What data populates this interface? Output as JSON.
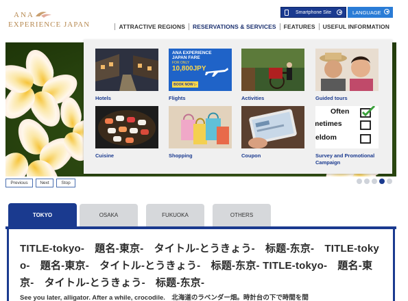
{
  "logo": {
    "line1": "ANA",
    "line2": "EXPERIENCE JAPAN"
  },
  "top_buttons": {
    "smartphone": "Smartphone Site",
    "language": "LANGUAGE"
  },
  "nav": [
    {
      "label": "ATTRACTIVE REGIONS"
    },
    {
      "label": "RESERVATIONS & SERVICES"
    },
    {
      "label": "FEATURES"
    },
    {
      "label": "USEFUL INFORMATION"
    }
  ],
  "dropdown": {
    "items": [
      {
        "label": "Hotels"
      },
      {
        "label": "Flights"
      },
      {
        "label": "Activities"
      },
      {
        "label": "Guided tours"
      },
      {
        "label": "Cuisine"
      },
      {
        "label": "Shopping"
      },
      {
        "label": "Coupon"
      },
      {
        "label": "Survey and Promotional Campaign"
      }
    ],
    "flights_ad": {
      "line1": "ANA EXPERIENCE",
      "line2": "JAPAN FARE",
      "line3": "FOR ONLY",
      "price": "10,800JPY",
      "cta": "BOOK NOW ▷"
    },
    "survey_words": [
      "Often",
      "metimes",
      "eldom"
    ]
  },
  "slider": {
    "previous": "Previous",
    "next": "Next",
    "stop": "Stop",
    "dot_count": 5,
    "active_dot": 3
  },
  "tabs": [
    {
      "label": "TOKYO",
      "active": true
    },
    {
      "label": "OSAKA",
      "active": false
    },
    {
      "label": "FUKUOKA",
      "active": false
    },
    {
      "label": "OTHERS",
      "active": false
    }
  ],
  "content": {
    "title": "TITLE-tokyo-　題名-東京-　タイトル-とうきょう-　标题-东京-　TITLE-tokyo-　題名-東京-　タイトル-とうきょう-　标题-东京- TITLE-tokyo-　題名-東京-　タイトル-とうきょう-　标题-东京-",
    "body": "See you later, alligator. After a while, crocodile.　北海道のラベンダー畑。時計台の下で時間を間"
  },
  "colors": {
    "brand_navy": "#1a3a8f",
    "brand_blue": "#2a7cd6",
    "gold": "#b78a52",
    "tab_inactive": "#d6d8db"
  }
}
